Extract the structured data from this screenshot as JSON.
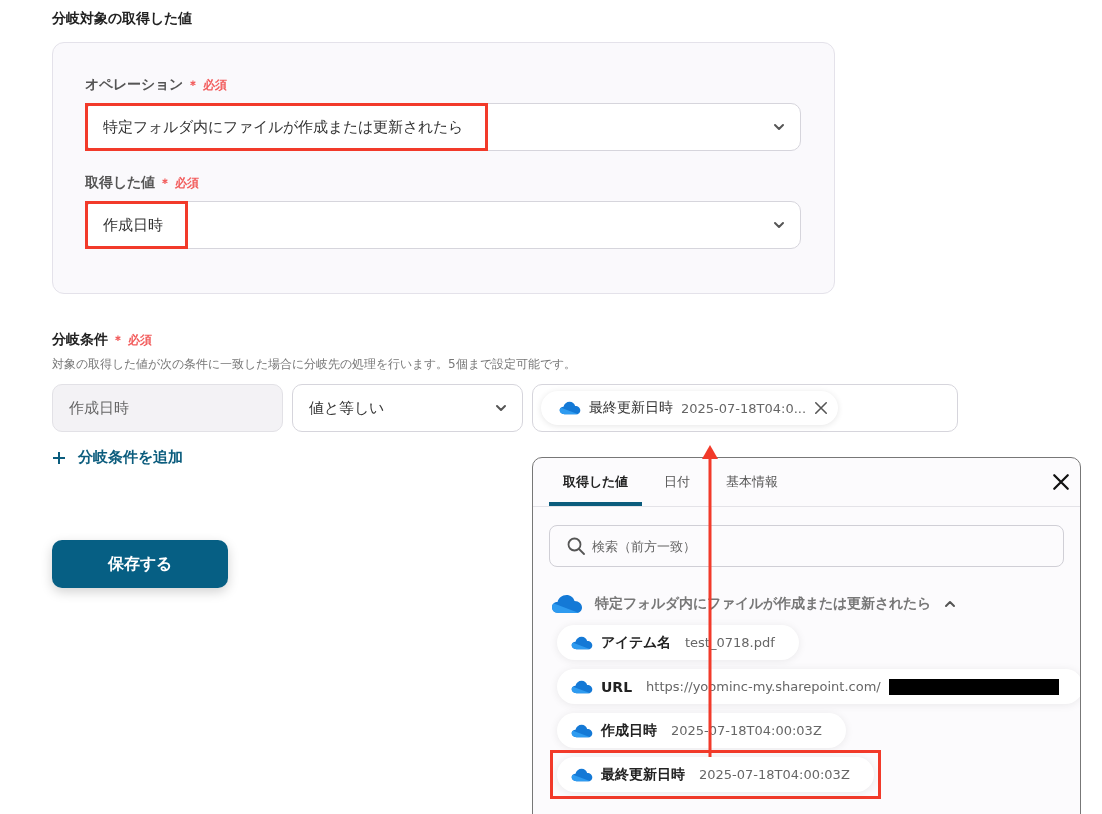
{
  "section_title": "分岐対象の取得した値",
  "fields": [
    {
      "label": "オペレーション",
      "required_mark": "＊",
      "required": "必須",
      "value": "特定フォルダ内にファイルが作成または更新されたら",
      "highlighted": true
    },
    {
      "label": "取得した値",
      "required_mark": "＊",
      "required": "必須",
      "value": "作成日時",
      "highlighted": true
    }
  ],
  "conditions": {
    "label": "分岐条件",
    "required_mark": "＊",
    "required": "必須",
    "description": "対象の取得した値が次の条件に一致した場合に分岐先の処理を行います。5個まで設定可能です。",
    "subject": "作成日時",
    "operator": "値と等しい",
    "chip": {
      "name": "最終更新日時",
      "value": "2025-07-18T04:0..."
    },
    "add_label": "分岐条件を追加"
  },
  "save_button": "保存する",
  "picker": {
    "tabs": [
      {
        "label": "取得した値",
        "selected": true
      },
      {
        "label": "日付",
        "selected": false
      },
      {
        "label": "基本情報",
        "selected": false
      }
    ],
    "search_placeholder": "検索（前方一致）",
    "group": {
      "title": "特定フォルダ内にファイルが作成または更新されたら",
      "expanded": true,
      "items": [
        {
          "name": "アイテム名",
          "value": "test_0718.pdf",
          "redacted": false,
          "highlighted": false
        },
        {
          "name": "URL",
          "value": "https://yoominc-my.sharepoint.com/",
          "redacted": true,
          "highlighted": false
        },
        {
          "name": "作成日時",
          "value": "2025-07-18T04:00:03Z",
          "redacted": false,
          "highlighted": false
        },
        {
          "name": "最終更新日時",
          "value": "2025-07-18T04:00:03Z",
          "redacted": false,
          "highlighted": true
        }
      ]
    }
  }
}
